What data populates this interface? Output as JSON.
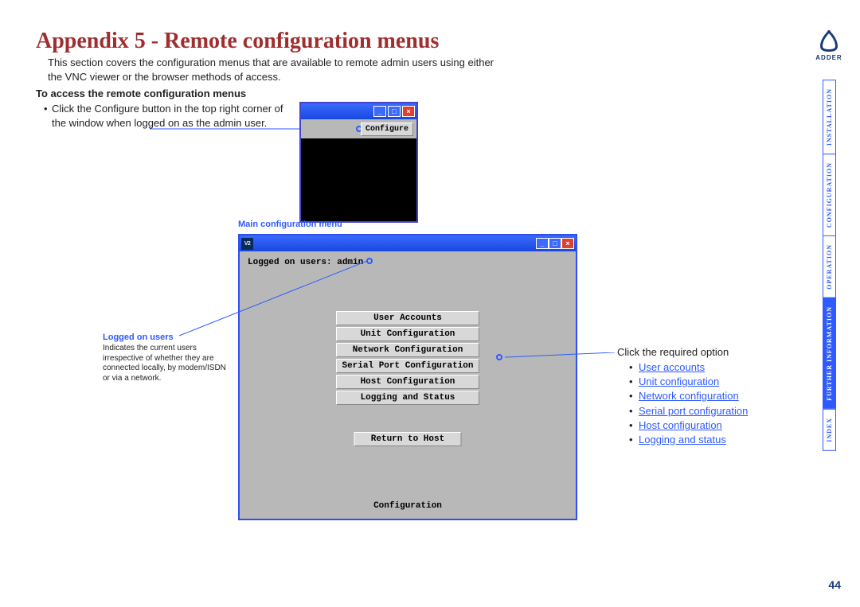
{
  "page": {
    "title": "Appendix 5 - Remote configuration menus",
    "intro": "This section covers the configuration menus that are available to remote admin users using either the VNC viewer or the browser methods of access.",
    "access_heading": "To access the remote configuration menus",
    "access_bullet": "Click the Configure button in the top right corner of the window when logged on as the admin user.",
    "page_number": "44"
  },
  "configure_button": {
    "label": "Configure"
  },
  "main_menu": {
    "caption": "Main configuration menu",
    "logged_on": "Logged on users: admin",
    "buttons": [
      "User Accounts",
      "Unit Configuration",
      "Network Configuration",
      "Serial Port Configuration",
      "Host Configuration",
      "Logging and Status"
    ],
    "return_label": "Return to Host",
    "footer_label": "Configuration"
  },
  "logged_callout": {
    "heading": "Logged on users",
    "text": "Indicates the current users irrespective of whether they are connected locally, by modem/ISDN or via a network."
  },
  "option_links": {
    "lead": "Click the required option",
    "items": [
      "User accounts",
      "Unit configuration",
      "Network configuration",
      "Serial port configuration",
      "Host configuration",
      "Logging and status"
    ]
  },
  "sidebar": {
    "tabs": [
      "INSTALLATION",
      "CONFIGURATION",
      "OPERATION",
      "FURTHER\nINFORMATION",
      "INDEX"
    ],
    "active_index": 3
  },
  "logo": {
    "text": "ADDER"
  }
}
